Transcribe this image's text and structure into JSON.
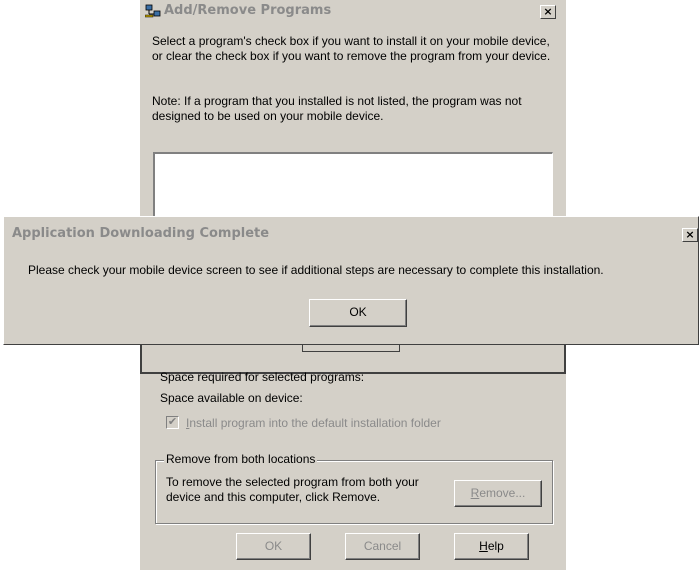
{
  "background_dialog": {
    "title": "Add/Remove Programs",
    "close_glyph": "×",
    "description": "Select a program's check box if you want to install it on your mobile device, or clear the check box if you want to remove the program from your device.",
    "note": "Note:  If a program that you installed is not listed, the program was not designed to be used on your mobile device.",
    "space_required_label": "Space required for selected programs:",
    "space_available_label": "Space available on device:",
    "install_checkbox": {
      "label_prefix": "",
      "label_underlined": "I",
      "label_rest": "nstall program into the default installation folder",
      "checked": true,
      "enabled": false
    },
    "remove_group": {
      "title": "Remove from both locations",
      "text": "To remove the selected program from both your device and this computer, click Remove.",
      "remove_button_underlined": "R",
      "remove_button_rest": "emove..."
    },
    "buttons": {
      "ok": "OK",
      "cancel": "Cancel",
      "help_underlined": "H",
      "help_rest": "elp"
    }
  },
  "foreground_dialog": {
    "title": "Application Downloading Complete",
    "close_glyph": "×",
    "message": "Please check your mobile device screen to see if additional steps are necessary to complete this installation.",
    "ok_button": "OK"
  },
  "icons": {
    "app_icon": "network-computer-icon",
    "close": "close-icon",
    "checkmark": "checkmark-icon"
  },
  "colors": {
    "dialog_face": "#d4d0c8",
    "inactive_title_text": "#8a8a8a",
    "disabled_text": "#8a8a8a"
  }
}
